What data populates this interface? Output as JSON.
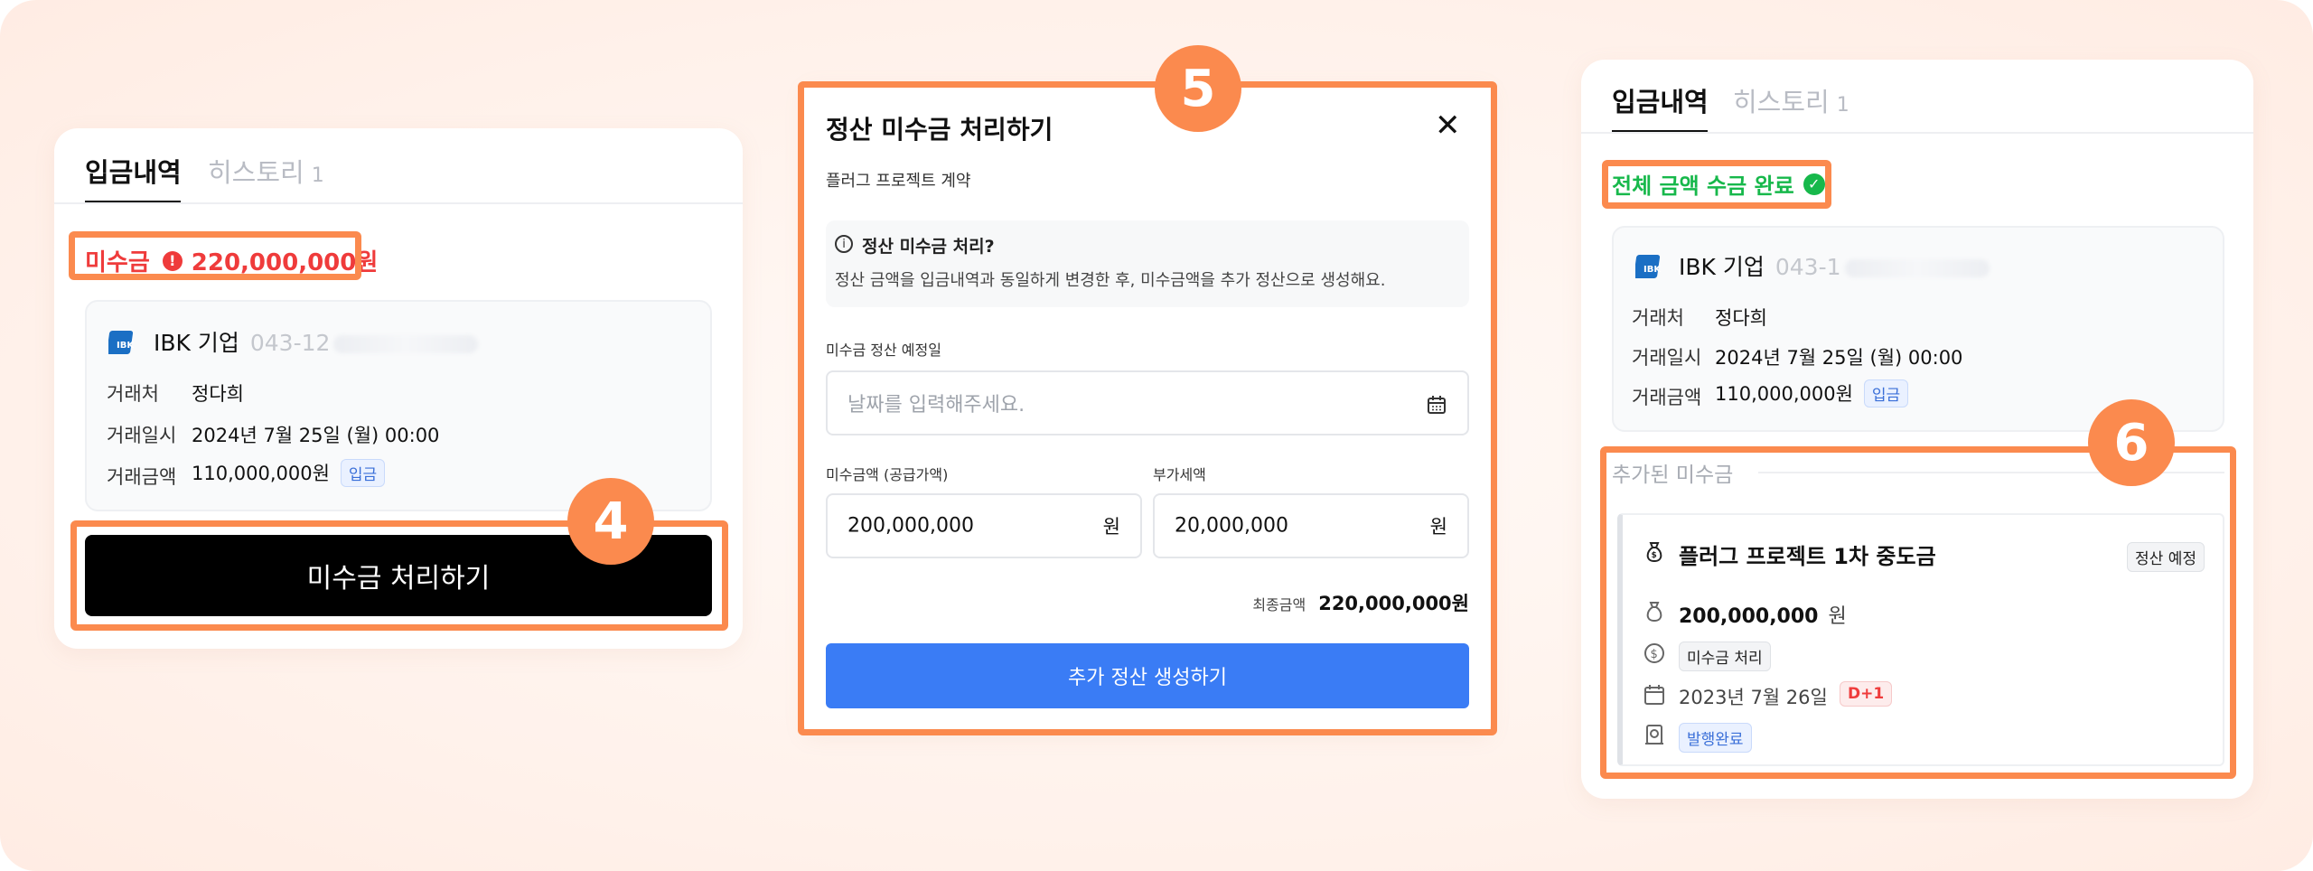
{
  "left": {
    "tabs": [
      {
        "label": "입금내역"
      },
      {
        "label": "히스토리",
        "count": "1"
      }
    ],
    "unpaid_label": "미수금",
    "unpaid_amount": "220,000,000원",
    "bank": {
      "name": "IBK 기업",
      "account": "043-12"
    },
    "rows": [
      {
        "label": "거래처",
        "value": "정다희"
      },
      {
        "label": "거래일시",
        "value": "2024년 7월 25일 (월) 00:00"
      },
      {
        "label": "거래금액",
        "value": "110,000,000원",
        "tag": "입금"
      }
    ],
    "action_button": "미수금 처리하기",
    "step_number": "4"
  },
  "modal": {
    "step_number": "5",
    "title": "정산 미수금 처리하기",
    "subtitle": "플러그 프로젝트 계약",
    "info_title": "정산 미수금 처리?",
    "info_text": "정산 금액을 입금내역과 동일하게 변경한 후, 미수금액을 추가 정산으로 생성해요.",
    "date_label": "미수금 정산 예정일",
    "date_placeholder": "날짜를 입력해주세요.",
    "amount_label": "미수금액 (공급가액)",
    "amount_value": "200,000,000",
    "amount_unit": "원",
    "vat_label": "부가세액",
    "vat_value": "20,000,000",
    "vat_unit": "원",
    "final_label": "최종금액",
    "final_value": "220,000,000원",
    "submit_button": "추가 정산 생성하기"
  },
  "right": {
    "tabs": [
      {
        "label": "입금내역"
      },
      {
        "label": "히스토리",
        "count": "1"
      }
    ],
    "complete_label": "전체 금액 수금 완료",
    "bank": {
      "name": "IBK 기업",
      "account": "043-1"
    },
    "rows": [
      {
        "label": "거래처",
        "value": "정다희"
      },
      {
        "label": "거래일시",
        "value": "2024년 7월 25일 (월) 00:00"
      },
      {
        "label": "거래금액",
        "value": "110,000,000원",
        "tag": "입금"
      }
    ],
    "added_section_title": "추가된 미수금",
    "step_number": "6",
    "item": {
      "title": "플러그 프로젝트 1차 중도금",
      "status": "정산 예정",
      "amount": "200,000,000",
      "amount_unit": "원",
      "type_chip": "미수금 처리",
      "date": "2023년 7월 26일",
      "dday": "D+1",
      "invoice_chip": "발행완료"
    }
  },
  "colors": {
    "accent_orange": "#fb8a4e",
    "danger_red": "#ef3b3b",
    "success_green": "#17b84b",
    "primary_blue": "#3a7cf5"
  }
}
